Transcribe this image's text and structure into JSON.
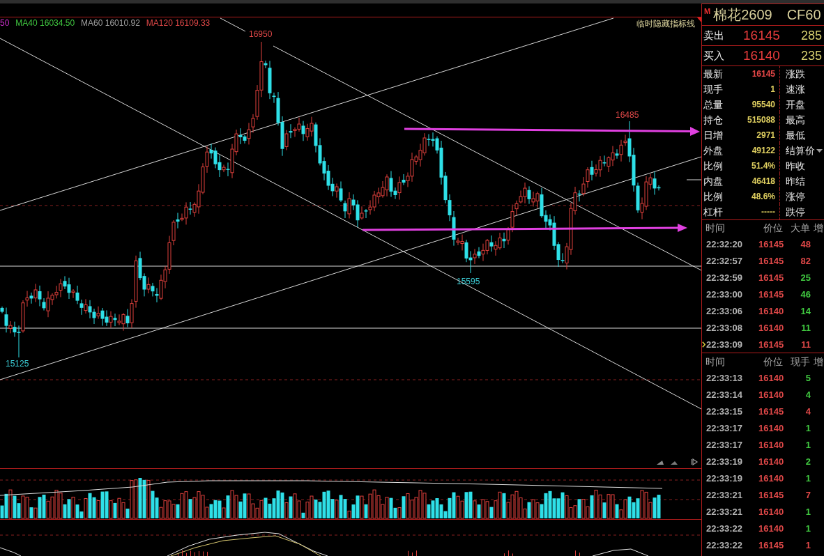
{
  "price_chart": {
    "ma_legend": [
      {
        "text": "50",
        "color": "#d030d0"
      },
      {
        "text": "MA40 16034.50",
        "color": "#40c840"
      },
      {
        "text": "MA60 16010.92",
        "color": "#a0a0a0"
      },
      {
        "text": "MA120 16109.33",
        "color": "#e04848"
      }
    ],
    "hide_lines_button": "临时隐藏指标线",
    "price_labels": [
      {
        "text": "16950",
        "kind": "high"
      },
      {
        "text": "16485",
        "kind": "high"
      },
      {
        "text": "15595",
        "kind": "low"
      },
      {
        "text": "15125",
        "kind": "low"
      }
    ]
  },
  "quote": {
    "badge": "M",
    "name": "棉花2609",
    "code": "CF60",
    "ask": {
      "label": "卖出",
      "price": "16145",
      "volume": "285"
    },
    "bid": {
      "label": "买入",
      "price": "16140",
      "volume": "235"
    },
    "stats": [
      {
        "label": "最新",
        "value": "16145",
        "color": "#e84848",
        "label_2": "涨跌",
        "kind": "plain"
      },
      {
        "label": "现手",
        "value": "1",
        "color": "#e0d060",
        "label_2": "速涨",
        "kind": "plain"
      },
      {
        "label": "总量",
        "value": "95540",
        "color": "#e0d060",
        "label_2": "开盘",
        "kind": "plain"
      },
      {
        "label": "持仓",
        "value": "515088",
        "color": "#e0d060",
        "label_2": "最高",
        "kind": "plain"
      },
      {
        "label": "日增",
        "value": "2971",
        "color": "#e0d060",
        "label_2": "最低",
        "kind": "plain"
      },
      {
        "label": "外盘",
        "value": "49122",
        "color": "#e0d060",
        "label_2": "结算价",
        "kind": "dropdown"
      },
      {
        "label": "比例",
        "value": "51.4%",
        "color": "#e0d060",
        "label_2": "昨收",
        "kind": "plain"
      },
      {
        "label": "内盘",
        "value": "46418",
        "color": "#e0d060",
        "label_2": "昨结",
        "kind": "plain"
      },
      {
        "label": "比例",
        "value": "48.6%",
        "color": "#e0d060",
        "label_2": "涨停",
        "kind": "plain"
      },
      {
        "label": "杠杆",
        "value": "-----",
        "color": "#e0d060",
        "label_2": "跌停",
        "kind": "plain"
      }
    ]
  },
  "big_orders": {
    "columns": [
      "时间",
      "价位",
      "大单",
      "增"
    ],
    "rows": [
      {
        "time": "22:32:20",
        "price": "16145",
        "volume": "48",
        "color": "#e04848",
        "selected": false
      },
      {
        "time": "22:32:57",
        "price": "16145",
        "volume": "82",
        "color": "#e04848",
        "selected": false
      },
      {
        "time": "22:32:59",
        "price": "16145",
        "volume": "25",
        "color": "#40c840",
        "selected": false
      },
      {
        "time": "22:33:00",
        "price": "16145",
        "volume": "46",
        "color": "#40c840",
        "selected": false
      },
      {
        "time": "22:33:06",
        "price": "16140",
        "volume": "14",
        "color": "#40c840",
        "selected": false
      },
      {
        "time": "22:33:08",
        "price": "16140",
        "volume": "11",
        "color": "#40c840",
        "selected": false
      },
      {
        "time": "22:33:09",
        "price": "16145",
        "volume": "11",
        "color": "#e04848",
        "selected": true
      }
    ]
  },
  "ticks": {
    "columns": [
      "时间",
      "价位",
      "现手",
      "增"
    ],
    "rows": [
      {
        "time": "22:33:13",
        "price": "16140",
        "volume": "5",
        "color": "#40c840",
        "selected": false
      },
      {
        "time": "22:33:14",
        "price": "16140",
        "volume": "4",
        "color": "#40c840",
        "selected": false
      },
      {
        "time": "22:33:15",
        "price": "16145",
        "volume": "4",
        "color": "#e04848",
        "selected": false
      },
      {
        "time": "22:33:17",
        "price": "16140",
        "volume": "1",
        "color": "#40c840",
        "selected": false
      },
      {
        "time": "22:33:17",
        "price": "16140",
        "volume": "1",
        "color": "#40c840",
        "selected": false
      },
      {
        "time": "22:33:19",
        "price": "16140",
        "volume": "2",
        "color": "#40c840",
        "selected": false
      },
      {
        "time": "22:33:19",
        "price": "16140",
        "volume": "1",
        "color": "#40c840",
        "selected": false
      },
      {
        "time": "22:33:21",
        "price": "16145",
        "volume": "7",
        "color": "#e04848",
        "selected": false
      },
      {
        "time": "22:33:21",
        "price": "16140",
        "volume": "1",
        "color": "#40c840",
        "selected": false
      },
      {
        "time": "22:33:22",
        "price": "16140",
        "volume": "1",
        "color": "#40c840",
        "selected": false
      },
      {
        "time": "22:33:22",
        "price": "16145",
        "volume": "1",
        "color": "#e04848",
        "selected": false
      }
    ]
  }
}
